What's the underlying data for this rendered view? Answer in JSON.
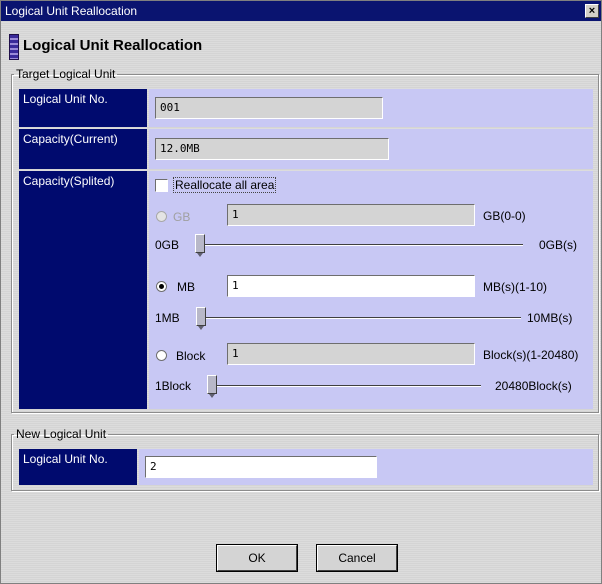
{
  "window": {
    "title": "Logical Unit Reallocation",
    "close_label": "×"
  },
  "header": {
    "title": "Logical Unit Reallocation",
    "icon": "storage-icon"
  },
  "target": {
    "legend": "Target Logical Unit",
    "lun_label": "Logical Unit No.",
    "lun_value": "001",
    "capacity_current_label": "Capacity(Current)",
    "capacity_current_value": "12.0MB",
    "capacity_splited_label": "Capacity(Splited)",
    "reallocate_all_label": "Reallocate all area",
    "reallocate_all_checked": false,
    "gb": {
      "label": "GB",
      "value": "1",
      "range": "GB(0-0)",
      "min": "0GB",
      "max": "0GB(s)",
      "selected": false,
      "enabled": false
    },
    "mb": {
      "label": "MB",
      "value": "1",
      "range": "MB(s)(1-10)",
      "min": "1MB",
      "max": "10MB(s)",
      "selected": true,
      "enabled": true
    },
    "block": {
      "label": "Block",
      "value": "1",
      "range": "Block(s)(1-20480)",
      "min": "1Block",
      "max": "20480Block(s)",
      "selected": false,
      "enabled": true
    }
  },
  "new_unit": {
    "legend": "New Logical Unit",
    "lun_label": "Logical Unit No.",
    "lun_value": "2"
  },
  "buttons": {
    "ok": "OK",
    "cancel": "Cancel"
  },
  "colors": {
    "titlebar": "#0a1470",
    "label_bg": "#000a6e",
    "value_bg": "#c8c8f4"
  }
}
